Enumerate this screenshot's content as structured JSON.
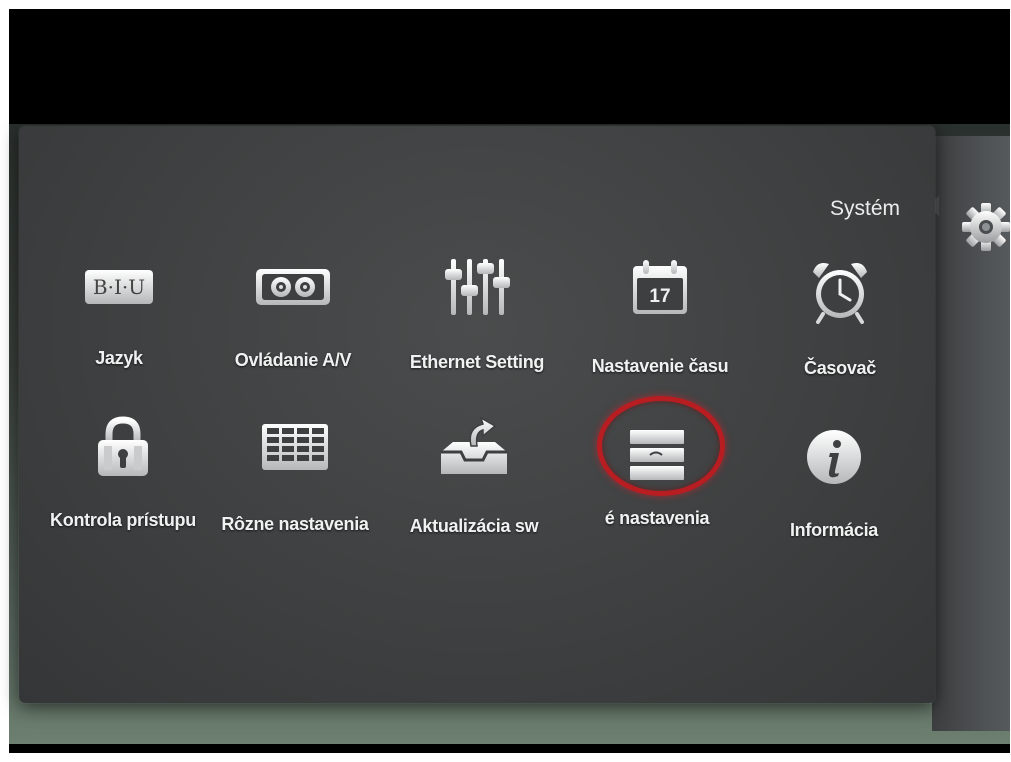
{
  "panel": {
    "title": "Systém"
  },
  "side": {
    "icon": "gear-icon"
  },
  "accent": {
    "selection_ring": "#b81d22"
  },
  "menu": {
    "items": [
      {
        "label": "Jazyk",
        "icon": "language-icon",
        "selected": false
      },
      {
        "label": "Ovládanie A/V",
        "icon": "av-connector-icon",
        "selected": false
      },
      {
        "label": "Ethernet Setting",
        "icon": "equalizer-sliders-icon",
        "selected": false
      },
      {
        "label": "Nastavenie času",
        "icon": "calendar-icon",
        "selected": false
      },
      {
        "label": "Časovač",
        "icon": "alarm-clock-icon",
        "selected": false
      },
      {
        "label": "Kontrola prístupu",
        "icon": "padlock-icon",
        "selected": false
      },
      {
        "label": "Rôzne nastavenia",
        "icon": "grid-table-icon",
        "selected": false
      },
      {
        "label": "Aktualizácia sw",
        "icon": "software-update-icon",
        "selected": false
      },
      {
        "label": "é nastavenia",
        "icon": "list-panel-icon",
        "selected": true
      },
      {
        "label": "Informácia",
        "icon": "info-icon",
        "selected": false
      }
    ],
    "calendar_day": "17"
  }
}
